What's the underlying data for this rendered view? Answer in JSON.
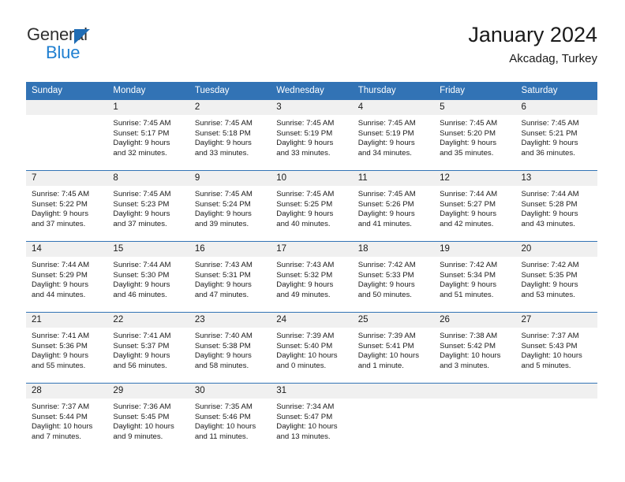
{
  "brand": {
    "name_top": "General",
    "name_bottom": "Blue",
    "triangle_color": "#1f6cb4",
    "blue_color": "#1f7fd0"
  },
  "header": {
    "title": "January 2024",
    "subtitle": "Akcadag, Turkey"
  },
  "theme": {
    "header_bg": "#3273b5",
    "header_text": "#ffffff",
    "daynum_band_bg": "#f0f0f0",
    "cell_bg": "#ffffff",
    "row_divider": "#3273b5",
    "text": "#1a1a1a"
  },
  "weekday_headers": [
    "Sunday",
    "Monday",
    "Tuesday",
    "Wednesday",
    "Thursday",
    "Friday",
    "Saturday"
  ],
  "labels": {
    "sunrise_prefix": "Sunrise:",
    "sunset_prefix": "Sunset:",
    "daylight_prefix": "Daylight:"
  },
  "weeks": [
    [
      {
        "day": "",
        "empty": true
      },
      {
        "day": "1",
        "sunrise": "Sunrise: 7:45 AM",
        "sunset": "Sunset: 5:17 PM",
        "daylight_line1": "Daylight: 9 hours",
        "daylight_line2": "and 32 minutes."
      },
      {
        "day": "2",
        "sunrise": "Sunrise: 7:45 AM",
        "sunset": "Sunset: 5:18 PM",
        "daylight_line1": "Daylight: 9 hours",
        "daylight_line2": "and 33 minutes."
      },
      {
        "day": "3",
        "sunrise": "Sunrise: 7:45 AM",
        "sunset": "Sunset: 5:19 PM",
        "daylight_line1": "Daylight: 9 hours",
        "daylight_line2": "and 33 minutes."
      },
      {
        "day": "4",
        "sunrise": "Sunrise: 7:45 AM",
        "sunset": "Sunset: 5:19 PM",
        "daylight_line1": "Daylight: 9 hours",
        "daylight_line2": "and 34 minutes."
      },
      {
        "day": "5",
        "sunrise": "Sunrise: 7:45 AM",
        "sunset": "Sunset: 5:20 PM",
        "daylight_line1": "Daylight: 9 hours",
        "daylight_line2": "and 35 minutes."
      },
      {
        "day": "6",
        "sunrise": "Sunrise: 7:45 AM",
        "sunset": "Sunset: 5:21 PM",
        "daylight_line1": "Daylight: 9 hours",
        "daylight_line2": "and 36 minutes."
      }
    ],
    [
      {
        "day": "7",
        "sunrise": "Sunrise: 7:45 AM",
        "sunset": "Sunset: 5:22 PM",
        "daylight_line1": "Daylight: 9 hours",
        "daylight_line2": "and 37 minutes."
      },
      {
        "day": "8",
        "sunrise": "Sunrise: 7:45 AM",
        "sunset": "Sunset: 5:23 PM",
        "daylight_line1": "Daylight: 9 hours",
        "daylight_line2": "and 37 minutes."
      },
      {
        "day": "9",
        "sunrise": "Sunrise: 7:45 AM",
        "sunset": "Sunset: 5:24 PM",
        "daylight_line1": "Daylight: 9 hours",
        "daylight_line2": "and 39 minutes."
      },
      {
        "day": "10",
        "sunrise": "Sunrise: 7:45 AM",
        "sunset": "Sunset: 5:25 PM",
        "daylight_line1": "Daylight: 9 hours",
        "daylight_line2": "and 40 minutes."
      },
      {
        "day": "11",
        "sunrise": "Sunrise: 7:45 AM",
        "sunset": "Sunset: 5:26 PM",
        "daylight_line1": "Daylight: 9 hours",
        "daylight_line2": "and 41 minutes."
      },
      {
        "day": "12",
        "sunrise": "Sunrise: 7:44 AM",
        "sunset": "Sunset: 5:27 PM",
        "daylight_line1": "Daylight: 9 hours",
        "daylight_line2": "and 42 minutes."
      },
      {
        "day": "13",
        "sunrise": "Sunrise: 7:44 AM",
        "sunset": "Sunset: 5:28 PM",
        "daylight_line1": "Daylight: 9 hours",
        "daylight_line2": "and 43 minutes."
      }
    ],
    [
      {
        "day": "14",
        "sunrise": "Sunrise: 7:44 AM",
        "sunset": "Sunset: 5:29 PM",
        "daylight_line1": "Daylight: 9 hours",
        "daylight_line2": "and 44 minutes."
      },
      {
        "day": "15",
        "sunrise": "Sunrise: 7:44 AM",
        "sunset": "Sunset: 5:30 PM",
        "daylight_line1": "Daylight: 9 hours",
        "daylight_line2": "and 46 minutes."
      },
      {
        "day": "16",
        "sunrise": "Sunrise: 7:43 AM",
        "sunset": "Sunset: 5:31 PM",
        "daylight_line1": "Daylight: 9 hours",
        "daylight_line2": "and 47 minutes."
      },
      {
        "day": "17",
        "sunrise": "Sunrise: 7:43 AM",
        "sunset": "Sunset: 5:32 PM",
        "daylight_line1": "Daylight: 9 hours",
        "daylight_line2": "and 49 minutes."
      },
      {
        "day": "18",
        "sunrise": "Sunrise: 7:42 AM",
        "sunset": "Sunset: 5:33 PM",
        "daylight_line1": "Daylight: 9 hours",
        "daylight_line2": "and 50 minutes."
      },
      {
        "day": "19",
        "sunrise": "Sunrise: 7:42 AM",
        "sunset": "Sunset: 5:34 PM",
        "daylight_line1": "Daylight: 9 hours",
        "daylight_line2": "and 51 minutes."
      },
      {
        "day": "20",
        "sunrise": "Sunrise: 7:42 AM",
        "sunset": "Sunset: 5:35 PM",
        "daylight_line1": "Daylight: 9 hours",
        "daylight_line2": "and 53 minutes."
      }
    ],
    [
      {
        "day": "21",
        "sunrise": "Sunrise: 7:41 AM",
        "sunset": "Sunset: 5:36 PM",
        "daylight_line1": "Daylight: 9 hours",
        "daylight_line2": "and 55 minutes."
      },
      {
        "day": "22",
        "sunrise": "Sunrise: 7:41 AM",
        "sunset": "Sunset: 5:37 PM",
        "daylight_line1": "Daylight: 9 hours",
        "daylight_line2": "and 56 minutes."
      },
      {
        "day": "23",
        "sunrise": "Sunrise: 7:40 AM",
        "sunset": "Sunset: 5:38 PM",
        "daylight_line1": "Daylight: 9 hours",
        "daylight_line2": "and 58 minutes."
      },
      {
        "day": "24",
        "sunrise": "Sunrise: 7:39 AM",
        "sunset": "Sunset: 5:40 PM",
        "daylight_line1": "Daylight: 10 hours",
        "daylight_line2": "and 0 minutes."
      },
      {
        "day": "25",
        "sunrise": "Sunrise: 7:39 AM",
        "sunset": "Sunset: 5:41 PM",
        "daylight_line1": "Daylight: 10 hours",
        "daylight_line2": "and 1 minute."
      },
      {
        "day": "26",
        "sunrise": "Sunrise: 7:38 AM",
        "sunset": "Sunset: 5:42 PM",
        "daylight_line1": "Daylight: 10 hours",
        "daylight_line2": "and 3 minutes."
      },
      {
        "day": "27",
        "sunrise": "Sunrise: 7:37 AM",
        "sunset": "Sunset: 5:43 PM",
        "daylight_line1": "Daylight: 10 hours",
        "daylight_line2": "and 5 minutes."
      }
    ],
    [
      {
        "day": "28",
        "sunrise": "Sunrise: 7:37 AM",
        "sunset": "Sunset: 5:44 PM",
        "daylight_line1": "Daylight: 10 hours",
        "daylight_line2": "and 7 minutes."
      },
      {
        "day": "29",
        "sunrise": "Sunrise: 7:36 AM",
        "sunset": "Sunset: 5:45 PM",
        "daylight_line1": "Daylight: 10 hours",
        "daylight_line2": "and 9 minutes."
      },
      {
        "day": "30",
        "sunrise": "Sunrise: 7:35 AM",
        "sunset": "Sunset: 5:46 PM",
        "daylight_line1": "Daylight: 10 hours",
        "daylight_line2": "and 11 minutes."
      },
      {
        "day": "31",
        "sunrise": "Sunrise: 7:34 AM",
        "sunset": "Sunset: 5:47 PM",
        "daylight_line1": "Daylight: 10 hours",
        "daylight_line2": "and 13 minutes."
      },
      {
        "day": "",
        "empty": true
      },
      {
        "day": "",
        "empty": true
      },
      {
        "day": "",
        "empty": true
      }
    ]
  ]
}
